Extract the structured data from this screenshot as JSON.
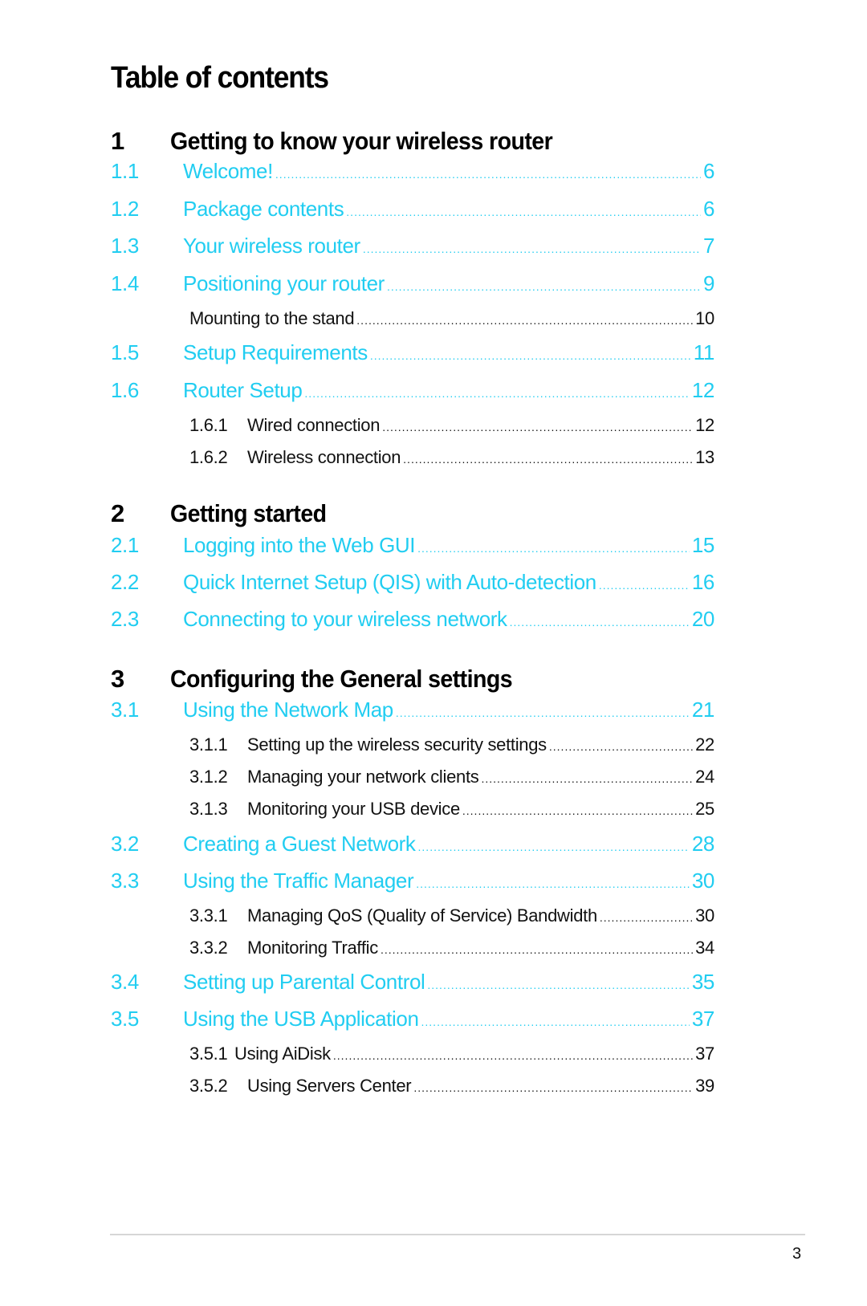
{
  "document": {
    "title": "Table of contents",
    "accent_color": "#21cdf1",
    "page_number": "3"
  },
  "chapters": [
    {
      "num": "1",
      "title": "Getting to know your wireless router",
      "entries": [
        {
          "level": 2,
          "num": "1.1",
          "label": "Welcome!",
          "page": "6"
        },
        {
          "level": 2,
          "num": "1.2",
          "label": "Package contents",
          "page": "6"
        },
        {
          "level": 2,
          "num": "1.3",
          "label": "Your wireless router",
          "page": "7"
        },
        {
          "level": 2,
          "num": "1.4",
          "label": "Positioning your router",
          "page": "9"
        },
        {
          "level": 3,
          "num": "",
          "label": "Mounting to the stand",
          "page": "10"
        },
        {
          "level": 2,
          "num": "1.5",
          "label": "Setup Requirements",
          "page": "11"
        },
        {
          "level": 2,
          "num": "1.6",
          "label": "Router Setup",
          "page": "12"
        },
        {
          "level": 3,
          "num": "1.6.1",
          "label": "Wired connection",
          "page": "12"
        },
        {
          "level": 3,
          "num": "1.6.2",
          "label": "Wireless connection",
          "page": "13"
        }
      ]
    },
    {
      "num": "2",
      "title": "Getting started",
      "entries": [
        {
          "level": 2,
          "num": "2.1",
          "label": "Logging into the Web GUI",
          "page": "15"
        },
        {
          "level": 2,
          "num": "2.2",
          "label": "Quick Internet Setup (QIS) with Auto-detection",
          "page": "16"
        },
        {
          "level": 2,
          "num": "2.3",
          "label": "Connecting to your wireless network",
          "page": "20"
        }
      ]
    },
    {
      "num": "3",
      "title": "Configuring the General settings",
      "entries": [
        {
          "level": 2,
          "num": "3.1",
          "label": "Using the Network Map",
          "page": "21"
        },
        {
          "level": 3,
          "num": "3.1.1",
          "label": "Setting up the wireless security settings",
          "page": "22"
        },
        {
          "level": 3,
          "num": "3.1.2",
          "label": "Managing your network clients",
          "page": "24"
        },
        {
          "level": 3,
          "num": "3.1.3",
          "label": "Monitoring your USB device",
          "page": "25"
        },
        {
          "level": 2,
          "num": "3.2",
          "label": "Creating a Guest Network",
          "page": "28"
        },
        {
          "level": 2,
          "num": "3.3",
          "label": "Using the Traffic Manager",
          "page": "30"
        },
        {
          "level": 3,
          "num": "3.3.1",
          "label": "Managing QoS (Quality of Service) Bandwidth",
          "page": "30"
        },
        {
          "level": 3,
          "num": "3.3.2",
          "label": "Monitoring Traffic",
          "page": "34"
        },
        {
          "level": 2,
          "num": "3.4",
          "label": "Setting up Parental Control",
          "page": "35"
        },
        {
          "level": 2,
          "num": "3.5",
          "label": "Using the USB Application",
          "page": "37"
        },
        {
          "level": 3,
          "num": "3.5.1",
          "label": "Using AiDisk",
          "page": "37"
        },
        {
          "level": 3,
          "num": "3.5.2",
          "label": "Using Servers Center",
          "page": "39"
        }
      ]
    }
  ]
}
